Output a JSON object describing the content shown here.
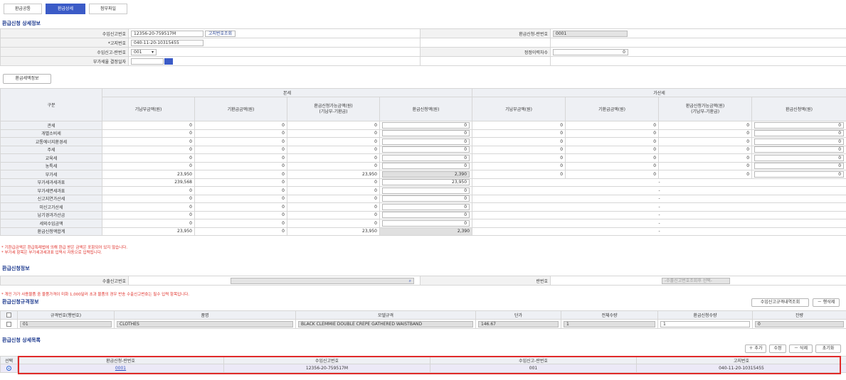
{
  "tabs": [
    {
      "label": "환급공통"
    },
    {
      "label": "환급상세"
    },
    {
      "label": "첨부파일"
    }
  ],
  "detail": {
    "title": "환급신청 상세정보",
    "import_no_label": "수입신고번호",
    "import_no_value": "12356-20-759517M",
    "lookup_btn": "고지번호조회",
    "refund_seq_label": "환급신청-란번호",
    "refund_seq_value": "0001",
    "notice_no_label": "*고지번호",
    "notice_no_value": "040-11-20-10315455",
    "import_line_label": "수입신고-란번호",
    "import_line_value": "001",
    "correction_label": "정정이력차수",
    "correction_value": "0",
    "vat_date_label": "부가세율 결정일자"
  },
  "tax_detail_button": "환급세액정보",
  "tax_table": {
    "group_headers": [
      "본세",
      "가산세"
    ],
    "row_header": "구분",
    "sub_headers": [
      "기납부금액(원)",
      "기환급금액(원)",
      "환급신청가능금액(원)\n(기납부-기환급)",
      "환급신청액(원)",
      "기납부금액(원)",
      "기환급금액(원)",
      "환급신청가능금액(원)\n(기납부-기환급)",
      "환급신청액(원)"
    ],
    "rows": [
      {
        "label": "관세",
        "v": [
          "0",
          "0",
          "0",
          "0",
          "0",
          "0",
          "0",
          "0"
        ]
      },
      {
        "label": "개별소비세",
        "v": [
          "0",
          "0",
          "0",
          "0",
          "0",
          "0",
          "0",
          "0"
        ]
      },
      {
        "label": "교통에너지환경세",
        "v": [
          "0",
          "0",
          "0",
          "0",
          "0",
          "0",
          "0",
          "0"
        ]
      },
      {
        "label": "주세",
        "v": [
          "0",
          "0",
          "0",
          "0",
          "0",
          "0",
          "0",
          "0"
        ]
      },
      {
        "label": "교육세",
        "v": [
          "0",
          "0",
          "0",
          "0",
          "0",
          "0",
          "0",
          "0"
        ]
      },
      {
        "label": "농특세",
        "v": [
          "0",
          "0",
          "0",
          "0",
          "0",
          "0",
          "0",
          "0"
        ]
      },
      {
        "label": "부가세",
        "v": [
          "23,950",
          "0",
          "23,950",
          "2,390",
          "0",
          "0",
          "0",
          "0"
        ]
      },
      {
        "label": "부가세과세과표",
        "v": [
          "239,568",
          "0",
          "0",
          "23,950"
        ],
        "dash": "-"
      },
      {
        "label": "부가세면세과표",
        "v": [
          "0",
          "0",
          "0",
          "0"
        ],
        "dash": "-"
      },
      {
        "label": "신고지연가산세",
        "v": [
          "0",
          "0",
          "0",
          "0"
        ],
        "dash": "-"
      },
      {
        "label": "미신고가산세",
        "v": [
          "0",
          "0",
          "0",
          "0"
        ],
        "dash": "-"
      },
      {
        "label": "납기경과가산금",
        "v": [
          "0",
          "0",
          "0",
          "0"
        ],
        "dash": "-"
      },
      {
        "label": "세외수입금액",
        "v": [
          "0",
          "0",
          "0",
          "0"
        ],
        "dash": "-"
      },
      {
        "label": "환급신청액합계",
        "v": [
          "23,950",
          "0",
          "23,950",
          "2,390"
        ],
        "dash": "-"
      }
    ],
    "notes": [
      "* 기환급금액은 환급특례법에 의해 환급 받은 금액은 포함되어 있지 않습니다.",
      "* 부가세 항목은 부가세과세과표 입력시 자동으로 입력됩니다."
    ]
  },
  "apply": {
    "title": "환급신청정보",
    "export_no_label": "수출신고번호",
    "line_no_label": "란번호",
    "line_no_placeholder": "-수출신고번호조회후 선택-",
    "note": "* 개인 가가 사용물품 중 물품가격이 미화 1,000달러 초과 물품의 경우 반송 수출신고번호는 필수 입력 항목입니다."
  },
  "spec": {
    "title": "환급신청규격정보",
    "btn_lookup": "수입신고규격내역조회",
    "btn_delete": "－ 행삭제",
    "headers": [
      "규격번호(행번호)",
      "품명",
      "모델규격",
      "단가",
      "전체수량",
      "환급신청수량",
      "잔량"
    ],
    "row": {
      "spec_no": "01",
      "name": "CLOTHES",
      "model": "BLACK CLEMMIE DOUBLE CREPE GATHERED WAISTBAND",
      "price": "146.67",
      "total_qty": "1",
      "refund_qty": "1",
      "remain": "0"
    }
  },
  "list": {
    "title": "환급신청 상세목록",
    "btn_add": "＋ 추가",
    "btn_edit": "수정",
    "btn_delete": "－ 삭제",
    "btn_reset": "초기화",
    "headers": [
      "선택",
      "환급신청-란번호",
      "수입신고번호",
      "수입신고-란번호",
      "고지번호"
    ],
    "row": {
      "refund_seq": "0001",
      "import_no": "12356-20-759517M",
      "import_line": "001",
      "notice_no": "040-11-20-10315455"
    }
  },
  "colors": {
    "accent": "#3b5bc7",
    "highlight": "#e02a2a",
    "note": "#e0302a"
  }
}
